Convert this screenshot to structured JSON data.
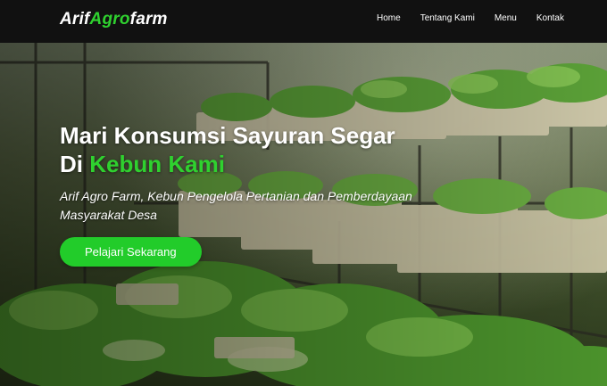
{
  "brand": {
    "part1": "Arif",
    "part2": "Agro",
    "part3": "farm",
    "accent_color": "#2fd12f"
  },
  "nav": {
    "items": [
      "Home",
      "Tentang Kami",
      "Menu",
      "Kontak"
    ]
  },
  "hero": {
    "title_line1": "Mari Konsumsi Sayuran Segar",
    "title_line2_prefix": "Di ",
    "title_line2_highlight": "Kebun Kami",
    "subtitle": "Arif Agro Farm, Kebun Pengelola Pertanian dan Pemberdayaan Masyarakat Desa",
    "cta_label": "Pelajari Sekarang",
    "cta_color": "#22cc2a",
    "background_image": "hydroponic-greenhouse-lettuce"
  }
}
